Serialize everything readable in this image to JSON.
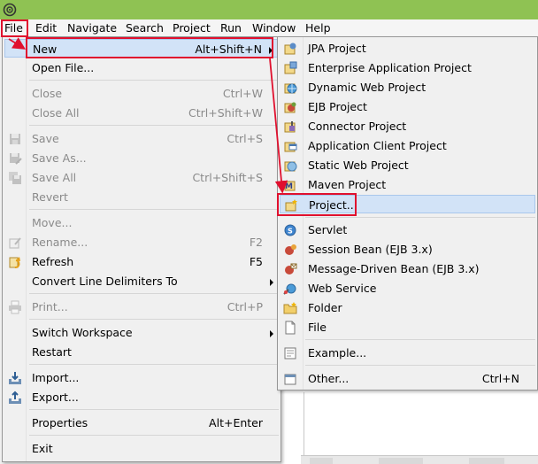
{
  "colors": {
    "titlebar": "#8fc253",
    "highlight": "#d2e3f7",
    "callout": "#e0102e"
  },
  "app_icon": "eclipse-icon",
  "menubar": {
    "items": [
      "File",
      "Edit",
      "Navigate",
      "Search",
      "Project",
      "Run",
      "Window",
      "Help"
    ]
  },
  "file_menu": {
    "items": [
      {
        "label": "New",
        "shortcut": "Alt+Shift+N",
        "submenu": true,
        "highlighted": true
      },
      {
        "label": "Open File...",
        "shortcut": ""
      },
      {
        "label": "Close",
        "shortcut": "Ctrl+W",
        "disabled": true
      },
      {
        "label": "Close All",
        "shortcut": "Ctrl+Shift+W",
        "disabled": true
      },
      {
        "label": "Save",
        "shortcut": "Ctrl+S",
        "disabled": true,
        "icon": "save-icon"
      },
      {
        "label": "Save As...",
        "shortcut": "",
        "disabled": true,
        "icon": "save-as-icon"
      },
      {
        "label": "Save All",
        "shortcut": "Ctrl+Shift+S",
        "disabled": true,
        "icon": "save-all-icon"
      },
      {
        "label": "Revert",
        "shortcut": "",
        "disabled": true
      },
      {
        "label": "Move...",
        "shortcut": "",
        "disabled": true
      },
      {
        "label": "Rename...",
        "shortcut": "F2",
        "disabled": true,
        "icon": "rename-icon"
      },
      {
        "label": "Refresh",
        "shortcut": "F5",
        "icon": "refresh-icon"
      },
      {
        "label": "Convert Line Delimiters To",
        "shortcut": "",
        "submenu": true
      },
      {
        "label": "Print...",
        "shortcut": "Ctrl+P",
        "disabled": true,
        "icon": "print-icon"
      },
      {
        "label": "Switch Workspace",
        "shortcut": "",
        "submenu": true
      },
      {
        "label": "Restart",
        "shortcut": ""
      },
      {
        "label": "Import...",
        "shortcut": "",
        "icon": "import-icon"
      },
      {
        "label": "Export...",
        "shortcut": "",
        "icon": "export-icon"
      },
      {
        "label": "Properties",
        "shortcut": "Alt+Enter"
      },
      {
        "label": "Exit",
        "shortcut": ""
      }
    ]
  },
  "new_menu": {
    "items": [
      {
        "label": "JPA Project",
        "icon": "jpa-project-icon"
      },
      {
        "label": "Enterprise Application Project",
        "icon": "enterprise-application-project-icon"
      },
      {
        "label": "Dynamic Web Project",
        "icon": "dynamic-web-project-icon"
      },
      {
        "label": "EJB Project",
        "icon": "ejb-project-icon"
      },
      {
        "label": "Connector Project",
        "icon": "connector-project-icon"
      },
      {
        "label": "Application Client Project",
        "icon": "application-client-project-icon"
      },
      {
        "label": "Static Web Project",
        "icon": "static-web-project-icon"
      },
      {
        "label": "Maven Project",
        "icon": "maven-project-icon"
      },
      {
        "label": "Project...",
        "icon": "new-project-icon",
        "highlighted": true
      },
      {
        "label": "Servlet",
        "icon": "servlet-icon"
      },
      {
        "label": "Session Bean (EJB 3.x)",
        "icon": "session-bean-icon"
      },
      {
        "label": "Message-Driven Bean (EJB 3.x)",
        "icon": "message-driven-bean-icon"
      },
      {
        "label": "Web Service",
        "icon": "web-service-icon"
      },
      {
        "label": "Folder",
        "icon": "folder-icon"
      },
      {
        "label": "File",
        "icon": "file-icon"
      },
      {
        "label": "Example...",
        "icon": "example-icon"
      },
      {
        "label": "Other...",
        "icon": "other-wizard-icon",
        "shortcut": "Ctrl+N"
      }
    ]
  }
}
